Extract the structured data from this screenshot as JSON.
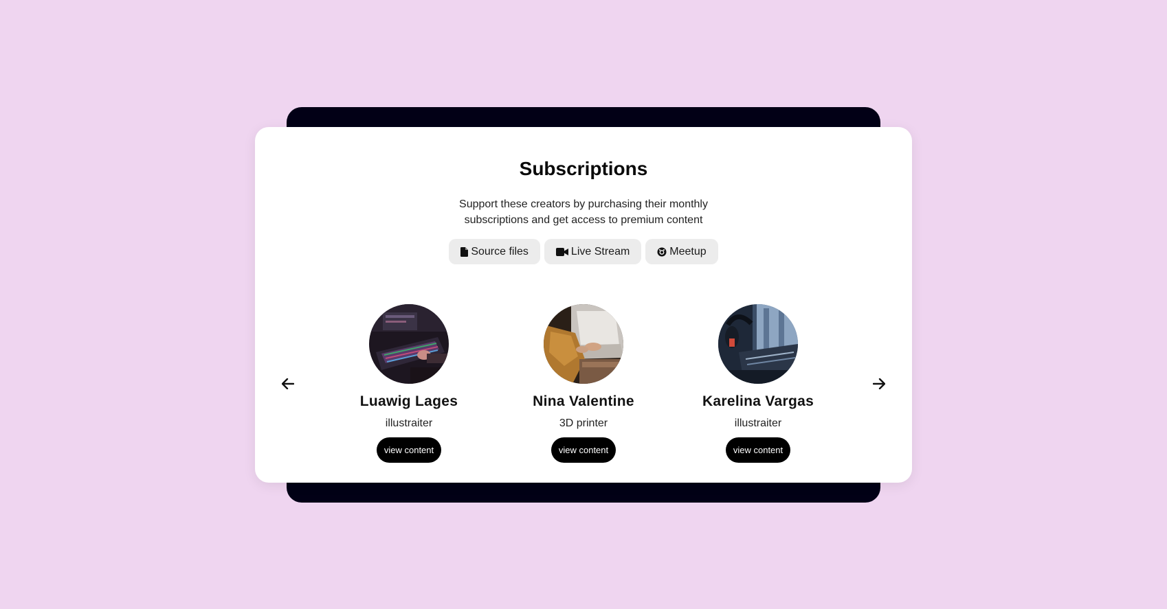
{
  "page": {
    "title": "Subscriptions",
    "description": "Support these creators by purchasing their monthly subscriptions and get access to premium content"
  },
  "tags": [
    {
      "label": "Source files",
      "icon": "file-icon"
    },
    {
      "label": "Live Stream",
      "icon": "video-camera-icon"
    },
    {
      "label": "Meetup",
      "icon": "meetup-icon"
    }
  ],
  "carousel": {
    "prev_icon": "arrow-left-icon",
    "next_icon": "arrow-right-icon"
  },
  "creators": [
    {
      "name": "Luawig Lages",
      "role": "illustraiter",
      "button": "view content",
      "avatar": "gaming-keyboard-photo"
    },
    {
      "name": "Nina Valentine",
      "role": "3D printer",
      "button": "view content",
      "avatar": "laptop-typing-photo"
    },
    {
      "name": "Karelina Vargas",
      "role": "illustraiter",
      "button": "view content",
      "avatar": "headphones-studio-photo"
    }
  ],
  "colors": {
    "background": "#efd5f0",
    "back_card": "#020016",
    "card": "#ffffff",
    "tag_bg": "#ececec",
    "button_bg": "#000000"
  }
}
